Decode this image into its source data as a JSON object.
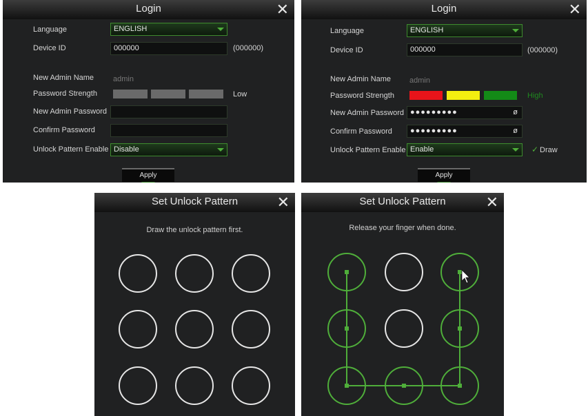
{
  "colors": {
    "accent_green": "#4fae3a",
    "strength_red": "#e8141a",
    "strength_yellow": "#f3ee10",
    "strength_green": "#138a17"
  },
  "login1": {
    "title": "Login",
    "language_label": "Language",
    "language_value": "ENGLISH",
    "device_id_label": "Device ID",
    "device_id_value": "000000",
    "device_id_hint": "(000000)",
    "admin_name_label": "New Admin Name",
    "admin_name_value": "admin",
    "strength_label": "Password Strength",
    "strength_text": "Low",
    "new_password_label": "New Admin Password",
    "new_password_value": "",
    "confirm_password_label": "Confirm Password",
    "confirm_password_value": "",
    "unlock_label": "Unlock Pattern Enable",
    "unlock_value": "Disable",
    "apply_label": "Apply"
  },
  "login2": {
    "title": "Login",
    "language_label": "Language",
    "language_value": "ENGLISH",
    "device_id_label": "Device ID",
    "device_id_value": "000000",
    "device_id_hint": "(000000)",
    "admin_name_label": "New Admin Name",
    "admin_name_value": "admin",
    "strength_label": "Password Strength",
    "strength_text": "High",
    "new_password_label": "New Admin Password",
    "new_password_value": "●●●●●●●●●",
    "confirm_password_label": "Confirm Password",
    "confirm_password_value": "●●●●●●●●●",
    "unlock_label": "Unlock Pattern Enable",
    "unlock_value": "Enable",
    "draw_label": "Draw",
    "apply_label": "Apply"
  },
  "pattern1": {
    "title": "Set Unlock Pattern",
    "hint": "Draw the unlock pattern first."
  },
  "pattern2": {
    "title": "Set Unlock Pattern",
    "hint": "Release your finger when done.",
    "selected_nodes": [
      1,
      4,
      7,
      8,
      9,
      6,
      3
    ]
  }
}
